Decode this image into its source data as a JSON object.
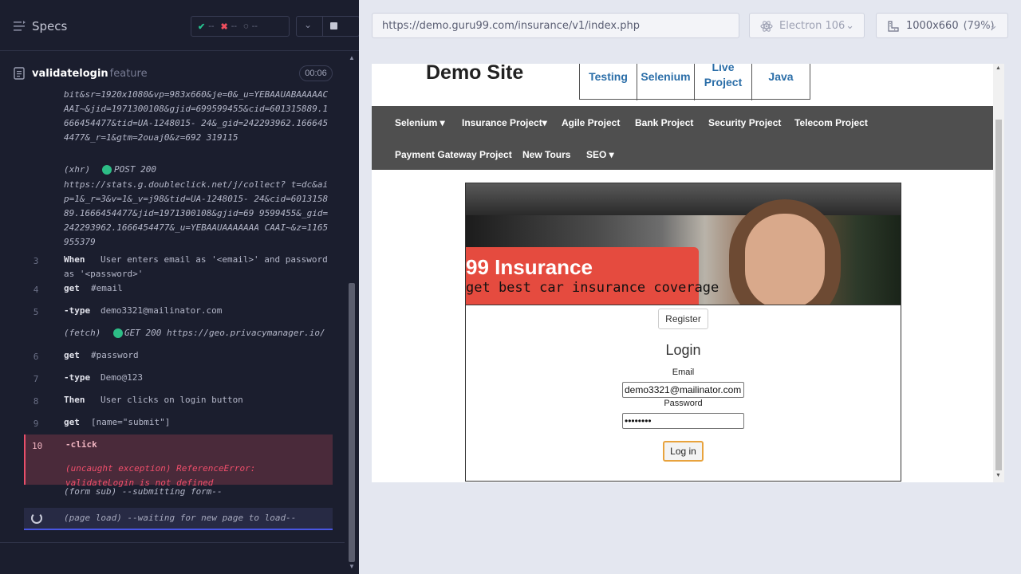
{
  "runner": {
    "specs_label": "Specs",
    "passed": "--",
    "failed": "--",
    "pending": "--"
  },
  "feature": {
    "name": "validatelogin",
    "ext": "feature",
    "time": "00:06"
  },
  "log": {
    "url_top": "bit&sr=1920x1080&vp=983x660&je=0&_u=YEBAAUABAAAAAC AAI~&jid=1971300108&gjid=699599455&cid=601315889.1 666454477&tid=UA-1248015- 24&_gid=242293962.1666454477&_r=1&gtm=2ouaj0&z=692 319115",
    "xhr_label": "(xhr)",
    "xhr_status": "POST 200",
    "xhr_url": "https://stats.g.doubleclick.net/j/collect? t=dc&aip=1&_r=3&v=1&_v=j98&tid=UA-1248015- 24&cid=601315889.1666454477&jid=1971300108&gjid=69 9599455&_gid=242293962.1666454477&_u=YEBAAUAAAAAAA CAAI~&z=1165955379",
    "steps": [
      {
        "num": "3",
        "name": "When",
        "msg": "User enters email as '<email>' and password"
      },
      {
        "msg2": "as '<password>'"
      },
      {
        "num": "4",
        "name": "get",
        "msg": "#email"
      },
      {
        "num": "5",
        "name": "-type",
        "msg": "demo3321@mailinator.com"
      },
      {
        "name": "(fetch)",
        "msg": "GET 200 https://geo.privacymanager.io/"
      },
      {
        "num": "6",
        "name": "get",
        "msg": "#password"
      },
      {
        "num": "7",
        "name": "-type",
        "msg": "Demo@123"
      },
      {
        "num": "8",
        "name": "Then",
        "msg": "User clicks on login button"
      },
      {
        "num": "9",
        "name": "get",
        "msg": "[name=\"submit\"]"
      }
    ],
    "error": {
      "num": "10",
      "name": "-click",
      "line1": "(uncaught exception)  ReferenceError:",
      "line2": "validateLogin is not defined"
    },
    "form_sub": "(form sub)  --submitting form--",
    "page_load": "(page load)  --waiting for new page to load--"
  },
  "browser": {
    "url": "https://demo.guru99.com/insurance/v1/index.php",
    "engine": "Electron 106",
    "viewport": "1000x660",
    "zoom": "(79%)"
  },
  "site": {
    "title": "Demo Site",
    "boxes": [
      "Testing",
      "Selenium",
      "Live Project",
      "Java"
    ],
    "nav": [
      "Selenium ▾",
      "Insurance Project▾",
      "Agile Project",
      "Bank Project",
      "Security Project",
      "Telecom Project",
      "Payment Gateway Project",
      "New Tours",
      "SEO ▾"
    ],
    "hero_title": "99 Insurance",
    "hero_tag": "get best car insurance coverage",
    "register": "Register",
    "login_heading": "Login",
    "email_label": "Email",
    "email_value": "demo3321@mailinator.com",
    "password_label": "Password",
    "password_value": "••••••••",
    "login_btn": "Log in"
  }
}
